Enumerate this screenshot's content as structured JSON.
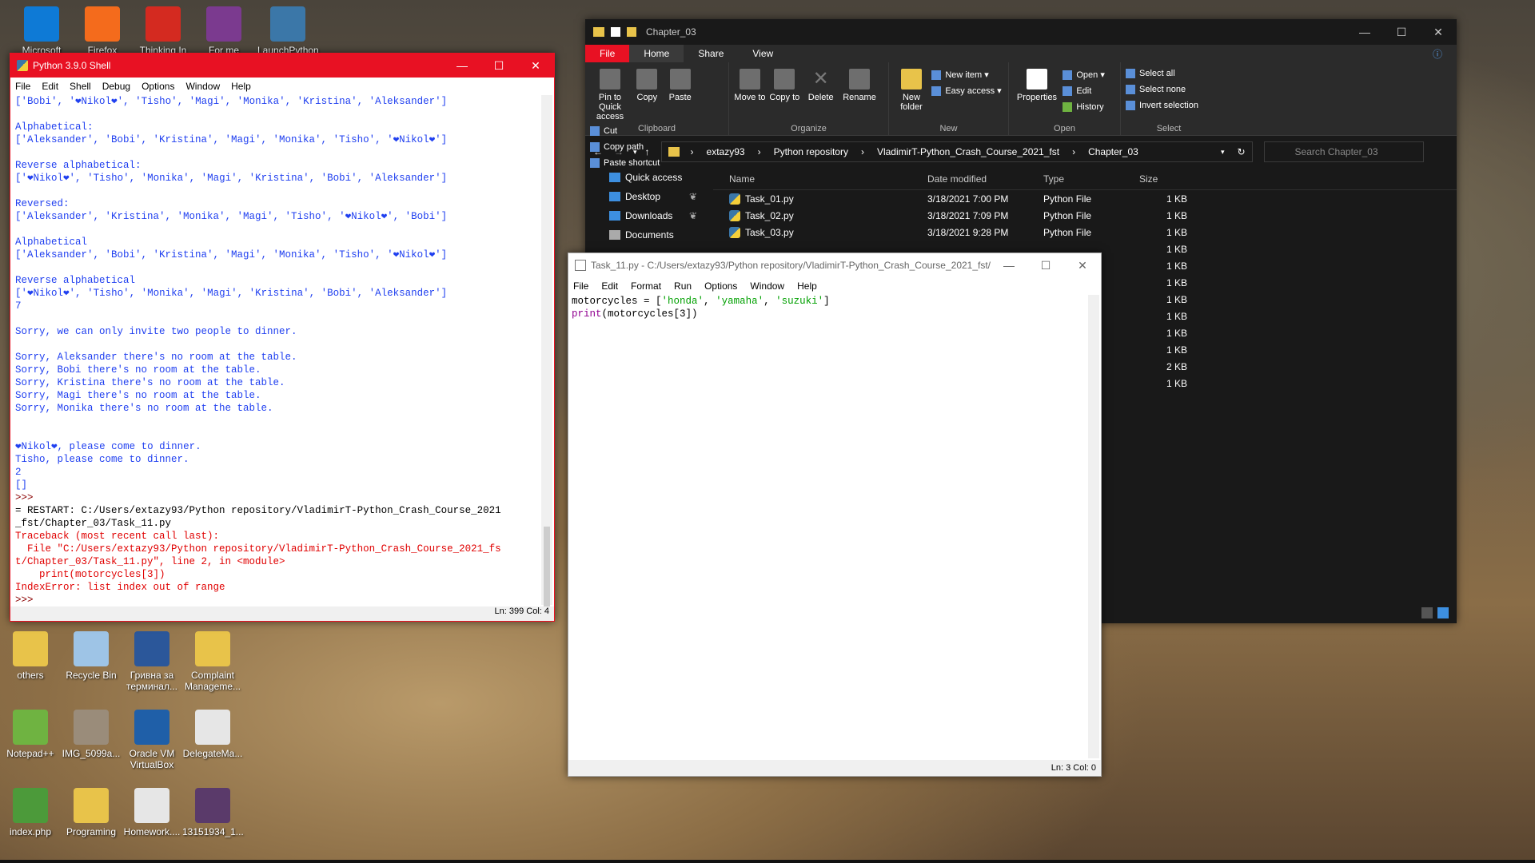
{
  "desktop": {
    "top_icons": [
      {
        "label": "Microsoft",
        "name": "edge-icon",
        "color": "#0e7ad6"
      },
      {
        "label": "Firefox",
        "name": "firefox-icon",
        "color": "#f46b1c"
      },
      {
        "label": "Thinking In",
        "name": "pdf-icon",
        "color": "#d42a20"
      },
      {
        "label": "For me",
        "name": "winrar-icon",
        "color": "#7b3a8f"
      },
      {
        "label": "LaunchPython",
        "name": "python-icon",
        "color": "#3b77a8"
      }
    ],
    "icons": [
      {
        "label": "others",
        "name": "folder-icon",
        "color": "#e8c34a"
      },
      {
        "label": "Recycle Bin",
        "name": "recycle-bin-icon",
        "color": "#9ec4e6"
      },
      {
        "label": "Гривна за терминал...",
        "name": "word-doc-icon",
        "color": "#2b579a"
      },
      {
        "label": "Complaint Manageme...",
        "name": "folder-icon",
        "color": "#e8c34a"
      },
      {
        "label": "Notepad++",
        "name": "notepad-plus-icon",
        "color": "#6fb341"
      },
      {
        "label": "IMG_5099a...",
        "name": "photo-icon",
        "color": "#9a8c7a"
      },
      {
        "label": "Oracle VM VirtualBox",
        "name": "virtualbox-icon",
        "color": "#1f5fa8"
      },
      {
        "label": "DelegateMa...",
        "name": "document-icon",
        "color": "#e6e6e6"
      },
      {
        "label": "index.php",
        "name": "php-file-icon",
        "color": "#4c9a3a"
      },
      {
        "label": "Programing",
        "name": "folder-icon",
        "color": "#e8c34a"
      },
      {
        "label": "Homework....",
        "name": "document-icon",
        "color": "#e6e6e6"
      },
      {
        "label": "13151934_1...",
        "name": "photo-icon",
        "color": "#5a3a6a"
      }
    ]
  },
  "shell": {
    "title": "Python 3.9.0 Shell",
    "menu": [
      "File",
      "Edit",
      "Shell",
      "Debug",
      "Options",
      "Window",
      "Help"
    ],
    "lines": [
      {
        "t": "['Bobi', '❤Nikol❤', 'Tisho', 'Magi', 'Monika', 'Kristina', 'Aleksander']",
        "c": "c-out"
      },
      {
        "t": "",
        "c": "c-out"
      },
      {
        "t": "Alphabetical:",
        "c": "c-out"
      },
      {
        "t": "['Aleksander', 'Bobi', 'Kristina', 'Magi', 'Monika', 'Tisho', '❤Nikol❤']",
        "c": "c-out"
      },
      {
        "t": "",
        "c": "c-out"
      },
      {
        "t": "Reverse alphabetical:",
        "c": "c-out"
      },
      {
        "t": "['❤Nikol❤', 'Tisho', 'Monika', 'Magi', 'Kristina', 'Bobi', 'Aleksander']",
        "c": "c-out"
      },
      {
        "t": "",
        "c": "c-out"
      },
      {
        "t": "Reversed:",
        "c": "c-out"
      },
      {
        "t": "['Aleksander', 'Kristina', 'Monika', 'Magi', 'Tisho', '❤Nikol❤', 'Bobi']",
        "c": "c-out"
      },
      {
        "t": "",
        "c": "c-out"
      },
      {
        "t": "Alphabetical",
        "c": "c-out"
      },
      {
        "t": "['Aleksander', 'Bobi', 'Kristina', 'Magi', 'Monika', 'Tisho', '❤Nikol❤']",
        "c": "c-out"
      },
      {
        "t": "",
        "c": "c-out"
      },
      {
        "t": "Reverse alphabetical",
        "c": "c-out"
      },
      {
        "t": "['❤Nikol❤', 'Tisho', 'Monika', 'Magi', 'Kristina', 'Bobi', 'Aleksander']",
        "c": "c-out"
      },
      {
        "t": "7",
        "c": "c-out"
      },
      {
        "t": "",
        "c": "c-out"
      },
      {
        "t": "Sorry, we can only invite two people to dinner.",
        "c": "c-out"
      },
      {
        "t": "",
        "c": "c-out"
      },
      {
        "t": "Sorry, Aleksander there's no room at the table.",
        "c": "c-out"
      },
      {
        "t": "Sorry, Bobi there's no room at the table.",
        "c": "c-out"
      },
      {
        "t": "Sorry, Kristina there's no room at the table.",
        "c": "c-out"
      },
      {
        "t": "Sorry, Magi there's no room at the table.",
        "c": "c-out"
      },
      {
        "t": "Sorry, Monika there's no room at the table.",
        "c": "c-out"
      },
      {
        "t": "",
        "c": "c-out"
      },
      {
        "t": "",
        "c": "c-out"
      },
      {
        "t": "❤Nikol❤, please come to dinner.",
        "c": "c-out"
      },
      {
        "t": "Tisho, please come to dinner.",
        "c": "c-out"
      },
      {
        "t": "2",
        "c": "c-out"
      },
      {
        "t": "[]",
        "c": "c-out"
      },
      {
        "t": ">>>",
        "c": "c-prompt"
      },
      {
        "t": "= RESTART: C:/Users/extazy93/Python repository/VladimirT-Python_Crash_Course_2021",
        "c": "c-plain"
      },
      {
        "t": "_fst/Chapter_03/Task_11.py",
        "c": "c-plain"
      },
      {
        "t": "Traceback (most recent call last):",
        "c": "c-err"
      },
      {
        "t": "  File \"C:/Users/extazy93/Python repository/VladimirT-Python_Crash_Course_2021_fs",
        "c": "c-err"
      },
      {
        "t": "t/Chapter_03/Task_11.py\", line 2, in <module>",
        "c": "c-err"
      },
      {
        "t": "    print(motorcycles[3])",
        "c": "c-err"
      },
      {
        "t": "IndexError: list index out of range",
        "c": "c-err"
      },
      {
        "t": ">>>",
        "c": "c-prompt"
      }
    ],
    "status": "Ln: 399   Col: 4"
  },
  "explorer": {
    "title": "Chapter_03",
    "tabs": [
      "File",
      "Home",
      "Share",
      "View"
    ],
    "clipboard": {
      "pin": "Pin to Quick access",
      "copy": "Copy",
      "paste": "Paste",
      "cut": "Cut",
      "copy_path": "Copy path",
      "paste_shortcut": "Paste shortcut",
      "group": "Clipboard"
    },
    "organize": {
      "move": "Move to",
      "copy": "Copy to",
      "delete": "Delete",
      "rename": "Rename",
      "group": "Organize"
    },
    "new": {
      "folder": "New folder",
      "item": "New item",
      "easy": "Easy access",
      "group": "New"
    },
    "open": {
      "properties": "Properties",
      "open": "Open",
      "edit": "Edit",
      "history": "History",
      "group": "Open"
    },
    "select": {
      "all": "Select all",
      "none": "Select none",
      "invert": "Invert selection",
      "group": "Select"
    },
    "breadcrumb": [
      "extazy93",
      "Python repository",
      "VladimirT-Python_Crash_Course_2021_fst",
      "Chapter_03"
    ],
    "search_placeholder": "Search Chapter_03",
    "nav": [
      "Quick access",
      "Desktop",
      "Downloads",
      "Documents"
    ],
    "columns": [
      "Name",
      "Date modified",
      "Type",
      "Size"
    ],
    "files": [
      {
        "name": "Task_01.py",
        "date": "3/18/2021 7:00 PM",
        "type": "Python File",
        "size": "1 KB"
      },
      {
        "name": "Task_02.py",
        "date": "3/18/2021 7:09 PM",
        "type": "Python File",
        "size": "1 KB"
      },
      {
        "name": "Task_03.py",
        "date": "3/18/2021 9:28 PM",
        "type": "Python File",
        "size": "1 KB"
      }
    ],
    "more_sizes": [
      "1 KB",
      "1 KB",
      "1 KB",
      "1 KB",
      "1 KB",
      "1 KB",
      "1 KB",
      "2 KB",
      "1 KB"
    ]
  },
  "editor": {
    "title": "Task_11.py - C:/Users/extazy93/Python repository/VladimirT-Python_Crash_Course_2021_fst/...",
    "menu": [
      "File",
      "Edit",
      "Format",
      "Run",
      "Options",
      "Window",
      "Help"
    ],
    "code_line1": {
      "a": "motorcycles = [",
      "s1": "'honda'",
      "sep1": ", ",
      "s2": "'yamaha'",
      "sep2": ", ",
      "s3": "'suzuki'",
      "b": "]"
    },
    "code_line2": {
      "kw": "print",
      "rest": "(motorcycles[3])"
    },
    "status": "Ln: 3   Col: 0"
  }
}
